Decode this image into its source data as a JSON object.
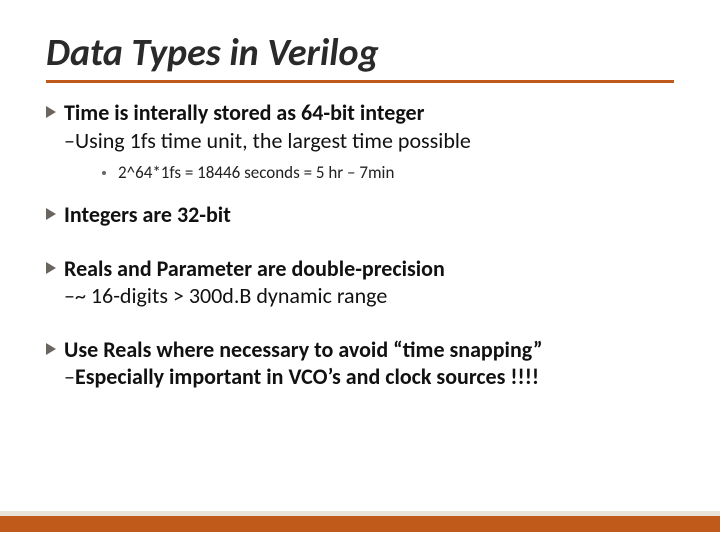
{
  "title": "Data Types in Verilog",
  "bullets": {
    "b1": {
      "line1": "Time is interally stored as 64-bit integer",
      "line2_prefix": "–",
      "line2": "Using 1fs time unit, the largest time possible",
      "sub": "2^64*1fs = 18446 seconds = 5 hr – 7min"
    },
    "b2": {
      "line1": "Integers are 32-bit"
    },
    "b3": {
      "line1": "Reals and Parameter are double-precision",
      "line2_prefix": "–",
      "line2": "~ 16-digits > 300d.B dynamic range"
    },
    "b4": {
      "line1": "Use Reals where necessary to avoid “time snapping”",
      "line2_prefix": "–",
      "line2": "Especially important in VCO’s and clock sources !!!!"
    }
  }
}
